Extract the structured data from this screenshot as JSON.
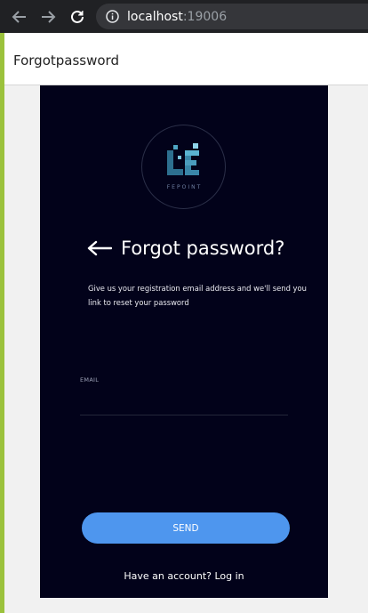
{
  "browser": {
    "url_host": "localhost",
    "url_port": ":19006"
  },
  "header": {
    "title": "Forgotpassword"
  },
  "logo": {
    "text": "FEPOINT"
  },
  "page": {
    "title": "Forgot password?",
    "description": "Give us your registration email address and we'll send you link to reset your password"
  },
  "form": {
    "email_label": "EMAIL",
    "email_value": "",
    "send_label": "SEND"
  },
  "footer": {
    "login_text": "Have an account? Log in"
  },
  "colors": {
    "panel_bg": "#02021a",
    "button": "#4e96ee",
    "accent_strip": "#9bc23c"
  }
}
